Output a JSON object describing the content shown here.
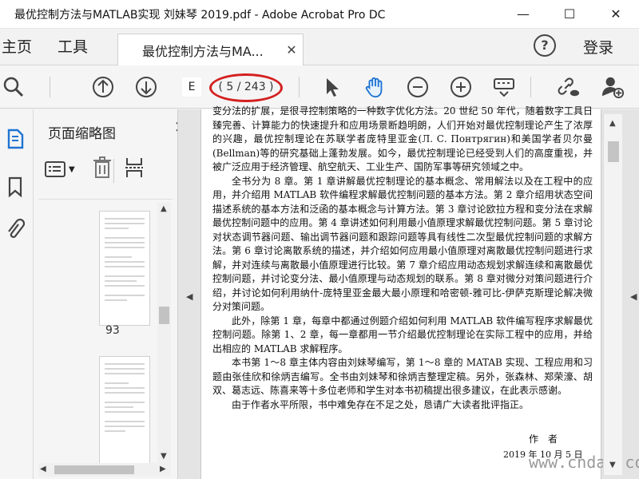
{
  "window": {
    "title": "最优控制方法与MATLAB实现 刘妹琴 2019.pdf - Adobe Acrobat Pro DC",
    "minimize": "—",
    "maximize": "☐",
    "close": "✕"
  },
  "tabs": {
    "home": "主页",
    "tools": "工具",
    "document": "最优控制方法与MA...",
    "document_close": "✕",
    "help": "?",
    "login": "登录"
  },
  "toolbar": {
    "page_input": "E",
    "page_count": "( 5 / 243 )",
    "highlight_color": "#d42020"
  },
  "thumbnails": {
    "title": "页面缩略图",
    "close": "✕",
    "page_number": "93"
  },
  "document": {
    "paragraphs": [
      "变分法的扩展，是很寻控制策略的一种数字优化方法。20 世纪 50 年代，随着数字工具日臻完善、计算能力的快速提升和应用场景断趋明朗，人们开始对最优控制理论产生了浓厚的兴趣，最优控制理论在苏联学者庞特里亚金(Л. С. Понтрягин)和美国学者贝尔曼(Bellman)等的研究基础上蓬勃发展。如今，最优控制理论已经受到人们的高度重视，并被广泛应用于经济管理、航空航天、工业生产、国防军事等研究领域之中。",
      "全书分为 8 章。第 1 章讲解最优控制理论的基本概念、常用解法以及在工程中的应用，并介绍用 MATLAB 软件编程求解最优控制问题的基本方法。第 2 章介绍用状态空间描述系统的基本方法和泛函的基本概念与计算方法。第 3 章讨论欧拉方程和变分法在求解最优控制问题中的应用。第 4 章讲述如何利用最小值原理求解最优控制问题。第 5 章讨论对状态调节器问题、输出调节器问题和跟踪问题等具有线性二次型最优控制问题的求解方法。第 6 章讨论离散系统的描述，并介绍如何应用最小值原理对离散最优控制问题进行求解，并对连续与离散最小值原理进行比较。第 7 章介绍应用动态规划求解连续和离散最优控制问题，并讨论变分法、最小值原理与动态规划的联系。第 8 章对微分对策问题进行介绍，并讨论如何利用纳什-庞特里亚金最大最小原理和哈密顿-雅可比-伊萨克斯理论解决微分对策问题。",
      "此外，除第 1 章，每章中都通过例题介绍如何利用 MATLAB 软件编写程序求解最优控制问题。除第 1、2 章，每一章都用一节介绍最优控制理论在实际工程中的应用，并给出相应的 MATLAB 求解程序。",
      "本书第 1～8 章主体内容由刘妹琴编写，第 1～8 章的 MATAB 实现、工程应用和习题由张佳欣和徐炳吉编写。全书由刘妹琴和徐炳吉整理定稿。另外，张森林、郑荣濠、胡双、葛志远、陈喜来等十多位老师和学生对本书初稿提出很多建议，在此表示感谢。",
      "由于作者水平所限，书中难免存在不足之处，恳请广大读者批评指正。"
    ],
    "signature": "作者",
    "date": "2019 年 10 月 5 日",
    "watermark": "www.cndao.com"
  }
}
